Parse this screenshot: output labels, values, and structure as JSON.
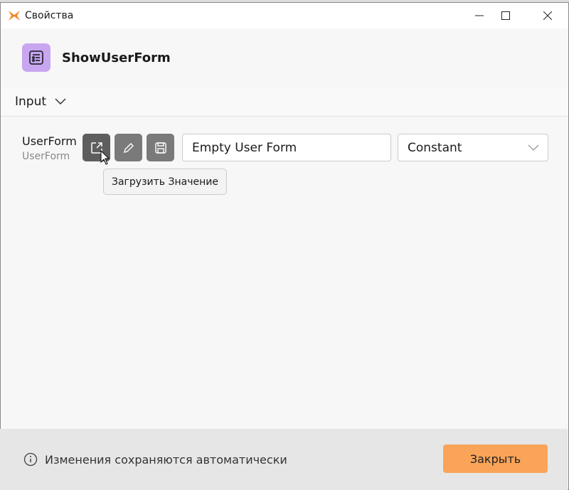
{
  "window": {
    "title": "Свойства",
    "minimize_icon": "minimize-icon",
    "maximize_icon": "maximize-icon",
    "close_icon": "close-icon"
  },
  "header": {
    "title": "ShowUserForm",
    "icon": "form-list-icon",
    "icon_color": "#c9a6f0"
  },
  "section": {
    "label": "Input",
    "icon": "chevron-down-icon"
  },
  "param": {
    "label": "UserForm",
    "type": "UserForm",
    "value": "Empty User Form",
    "mode": "Constant"
  },
  "buttons": {
    "load_icon": "open-external-icon",
    "edit_icon": "pencil-icon",
    "save_icon": "floppy-disk-icon"
  },
  "tooltip": "Загрузить Значение",
  "footer": {
    "message": "Изменения сохраняются автоматически",
    "close_label": "Закрыть",
    "accent": "#f9a458"
  }
}
